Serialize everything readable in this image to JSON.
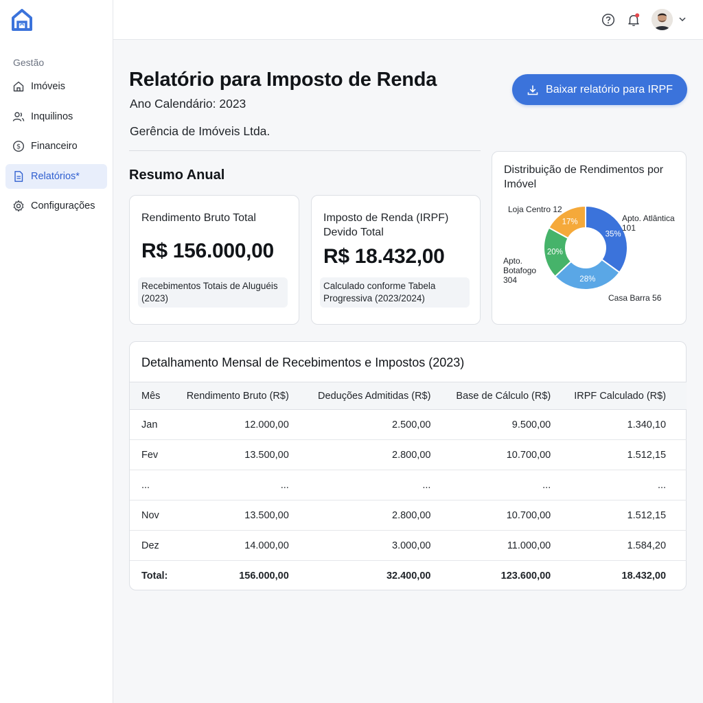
{
  "sidebar": {
    "section_title": "Gestão",
    "items": [
      {
        "label": "Imóveis",
        "icon": "home-icon"
      },
      {
        "label": "Inquilinos",
        "icon": "users-icon"
      },
      {
        "label": "Financeiro",
        "icon": "dollar-icon"
      },
      {
        "label": "Relatórios*",
        "icon": "document-icon",
        "active": true
      },
      {
        "label": "Configurações",
        "icon": "gear-icon"
      }
    ]
  },
  "topbar": {
    "icons": [
      "help-icon",
      "bell-icon",
      "avatar",
      "chevron-down-icon"
    ],
    "notification_dot_color": "#e5484d"
  },
  "header": {
    "title": "Relatório para Imposto de Renda",
    "subtitle": "Ano Calendário: 2023",
    "company": "Gerência de Imóveis Ltda.",
    "download_label": "Baixar relatório para IRPF"
  },
  "summary": {
    "heading": "Resumo Anual",
    "gross": {
      "label": "Rendimento Bruto Total",
      "value": "R$ 156.000,00",
      "note": "Recebimentos Totais de Aluguéis (2023)"
    },
    "tax": {
      "label": "Imposto de Renda (IRPF) Devido Total",
      "value": "R$ 18.432,00",
      "note": "Calculado conforme Tabela Progressiva (2023/2024)"
    }
  },
  "chart_data": {
    "type": "pie",
    "title": "Distribuição de Rendimentos por Imóvel",
    "donut": true,
    "series": [
      {
        "name": "Apto. Atlântica 101",
        "value": 35,
        "label": "35%",
        "color": "#3b73db"
      },
      {
        "name": "Casa Barra 56",
        "value": 28,
        "label": "28%",
        "color": "#5aa7e6"
      },
      {
        "name": "Apto. Botafogo 304",
        "value": 20,
        "label": "20%",
        "color": "#46b36a"
      },
      {
        "name": "Loja Centro 12",
        "value": 17,
        "label": "17%",
        "color": "#f5a93a"
      }
    ]
  },
  "table": {
    "title": "Detalhamento Mensal de Recebimentos e Impostos (2023)",
    "columns": [
      "Mês",
      "Rendimento Bruto (R$)",
      "Deduções Admitidas (R$)",
      "Base de Cálculo (R$)",
      "IRPF Calculado (R$)"
    ],
    "rows": [
      [
        "Jan",
        "12.000,00",
        "2.500,00",
        "9.500,00",
        "1.340,10"
      ],
      [
        "Fev",
        "13.500,00",
        "2.800,00",
        "10.700,00",
        "1.512,15"
      ],
      [
        "...",
        "...",
        "...",
        "...",
        "..."
      ],
      [
        "Nov",
        "13.500,00",
        "2.800,00",
        "10.700,00",
        "1.512,15"
      ],
      [
        "Dez",
        "14.000,00",
        "3.000,00",
        "11.000,00",
        "1.584,20"
      ]
    ],
    "total": [
      "Total:",
      "156.000,00",
      "32.400,00",
      "123.600,00",
      "18.432,00"
    ]
  },
  "colors": {
    "accent": "#3b73db",
    "active_nav_bg": "#e8eefb",
    "active_nav_text": "#2f5fd0"
  }
}
